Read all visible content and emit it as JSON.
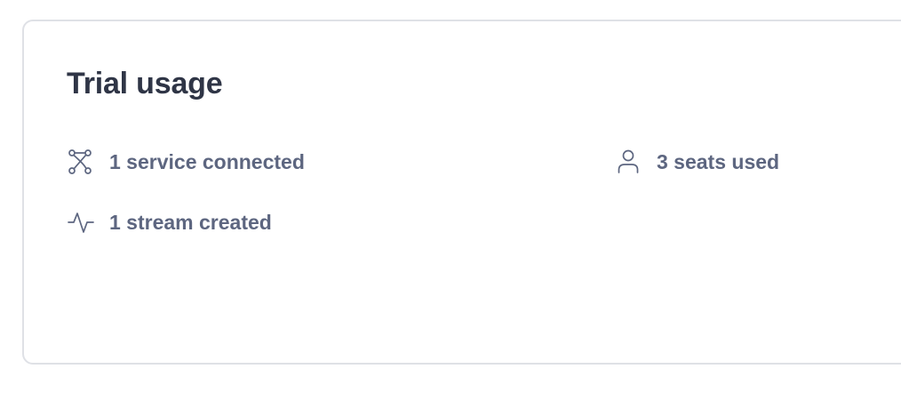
{
  "card": {
    "title": "Trial usage",
    "stats": [
      {
        "icon": "connection-nodes-icon",
        "label": "1 service connected"
      },
      {
        "icon": "user-icon",
        "label": "3 seats used"
      },
      {
        "icon": "activity-pulse-icon",
        "label": "1 stream created"
      }
    ]
  },
  "colors": {
    "title": "#2f3546",
    "text": "#5d6680",
    "border": "#dfe1e6",
    "background": "#ffffff"
  }
}
